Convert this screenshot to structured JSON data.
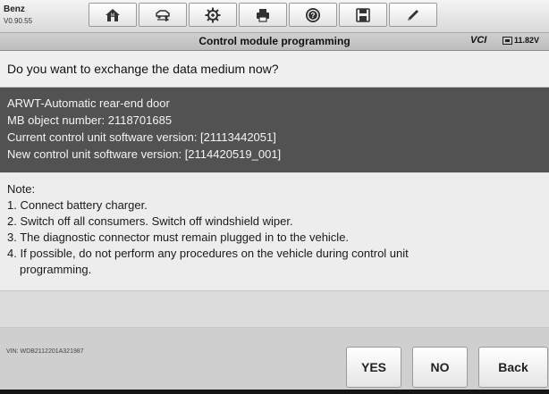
{
  "vehicle": {
    "name": "Benz",
    "version": "V0.90.55"
  },
  "toolbar": {
    "buttons": [
      {
        "icon": "home-icon"
      },
      {
        "icon": "vehicle-swap-icon"
      },
      {
        "icon": "gear-icon"
      },
      {
        "icon": "print-icon"
      },
      {
        "icon": "help-icon"
      },
      {
        "icon": "save-icon"
      },
      {
        "icon": "pen-icon"
      }
    ]
  },
  "title_bar": {
    "title": "Control module programming",
    "vci": "VCI",
    "battery": "11.82V"
  },
  "question": "Do you want to exchange the data medium now?",
  "info": {
    "lines": [
      "ARWT-Automatic rear-end door",
      "MB object number: 2118701685",
      "Current control unit software version: [21113442051]",
      "New control unit software version: [2114420519_001]"
    ]
  },
  "notes": {
    "heading": "Note:",
    "items": [
      "1. Connect battery charger.",
      "2. Switch off all consumers. Switch off windshield wiper.",
      "3. The diagnostic connector must remain plugged in to the vehicle.",
      "4. If possible, do not perform any procedures on the vehicle during control unit",
      "programming."
    ]
  },
  "footer": {
    "vin": "VIN: WDB2112201A321987"
  },
  "buttons": {
    "yes": "YES",
    "no": "NO",
    "back": "Back"
  },
  "colors": {
    "info_bg": "#525252",
    "toolbar_bg": "#e6e6e6",
    "screen_bg": "#e4e4e4"
  }
}
